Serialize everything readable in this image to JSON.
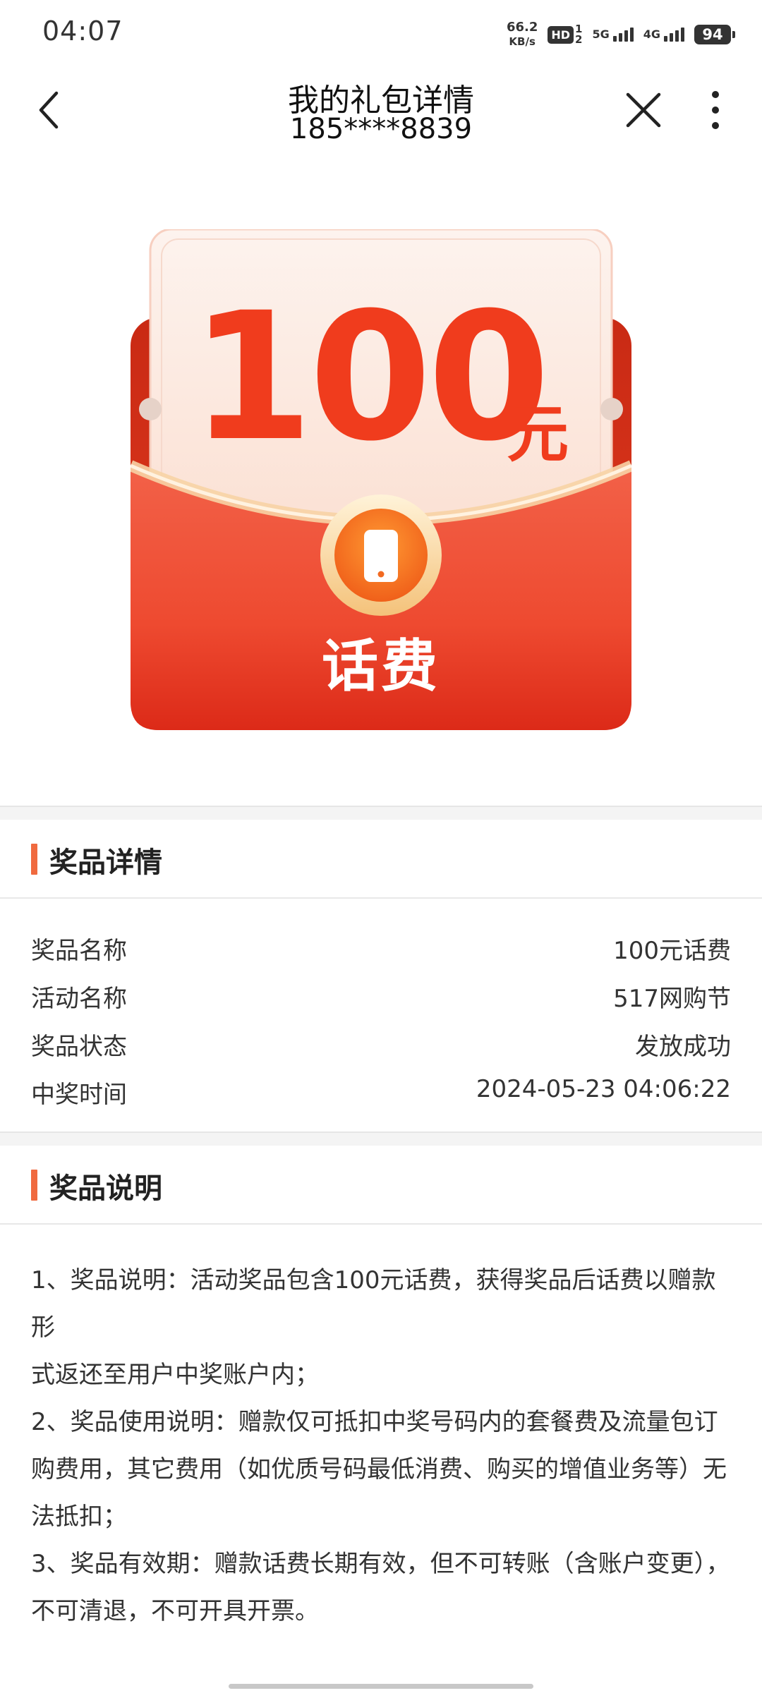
{
  "status_bar": {
    "time": "04:07",
    "net_speed_value": "66.2",
    "net_speed_unit": "KB/s",
    "hd_tag": "HD",
    "sim_1": "1",
    "sim_2": "2",
    "net_5g": "5G",
    "net_4g": "4G",
    "battery": "94"
  },
  "nav": {
    "title": "我的礼包详情",
    "subtitle": "185****8839",
    "back_icon": "chevron-left-icon",
    "close_icon": "close-icon",
    "more_icon": "more-vertical-icon"
  },
  "prize_card": {
    "amount": "100",
    "unit": "元",
    "label": "话费",
    "icon": "phone-icon",
    "colors": {
      "red": "#f03c1d",
      "card": "#fdeee6",
      "gold": "#f5c16b"
    }
  },
  "detail_section": {
    "title": "奖品详情",
    "rows": [
      {
        "label": "奖品名称",
        "value": "100元话费"
      },
      {
        "label": "活动名称",
        "value": "517网购节"
      },
      {
        "label": "奖品状态",
        "value": "发放成功"
      },
      {
        "label": "中奖时间",
        "value": "2024-05-23 04:06:22"
      }
    ]
  },
  "desc_section": {
    "title": "奖品说明",
    "lines": [
      "1、奖品说明：活动奖品包含100元话费，获得奖品后话费以赠款形",
      "式返还至用户中奖账户内；",
      "2、奖品使用说明：赠款仅可抵扣中奖号码内的套餐费及流量包订",
      "购费用，其它费用（如优质号码最低消费、购买的增值业务等）无",
      "法抵扣；",
      "3、奖品有效期：赠款话费长期有效，但不可转账（含账户变更），",
      "不可清退，不可开具开票。"
    ]
  }
}
